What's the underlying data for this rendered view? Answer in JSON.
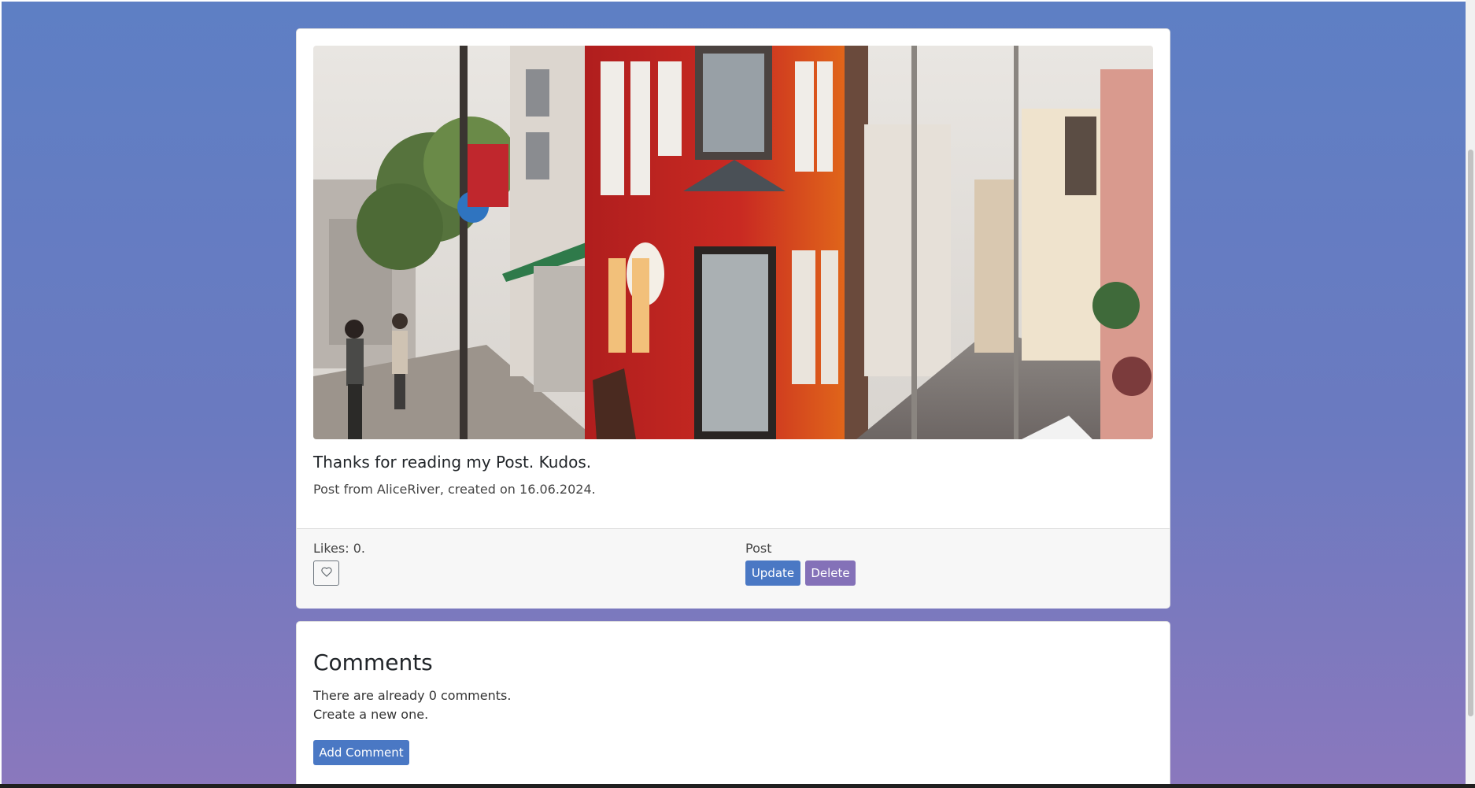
{
  "post": {
    "image_alt": "Street in Japan with a red corner shop",
    "title": "Thanks for reading my Post. Kudos.",
    "meta": "Post from AliceRiver, created on 16.06.2024.",
    "likes_text": "Likes: 0.",
    "like_icon": "heart-outline-icon",
    "section_label": "Post",
    "update_label": "Update",
    "delete_label": "Delete"
  },
  "comments": {
    "heading": "Comments",
    "count_text": "There are already 0 comments.",
    "prompt_text": "Create a new one.",
    "add_label": "Add Comment"
  },
  "colors": {
    "background_top": "#5e7fc4",
    "background_bottom": "#8a78bd",
    "primary_button": "#4a78c4",
    "secondary_button": "#8471b8"
  }
}
